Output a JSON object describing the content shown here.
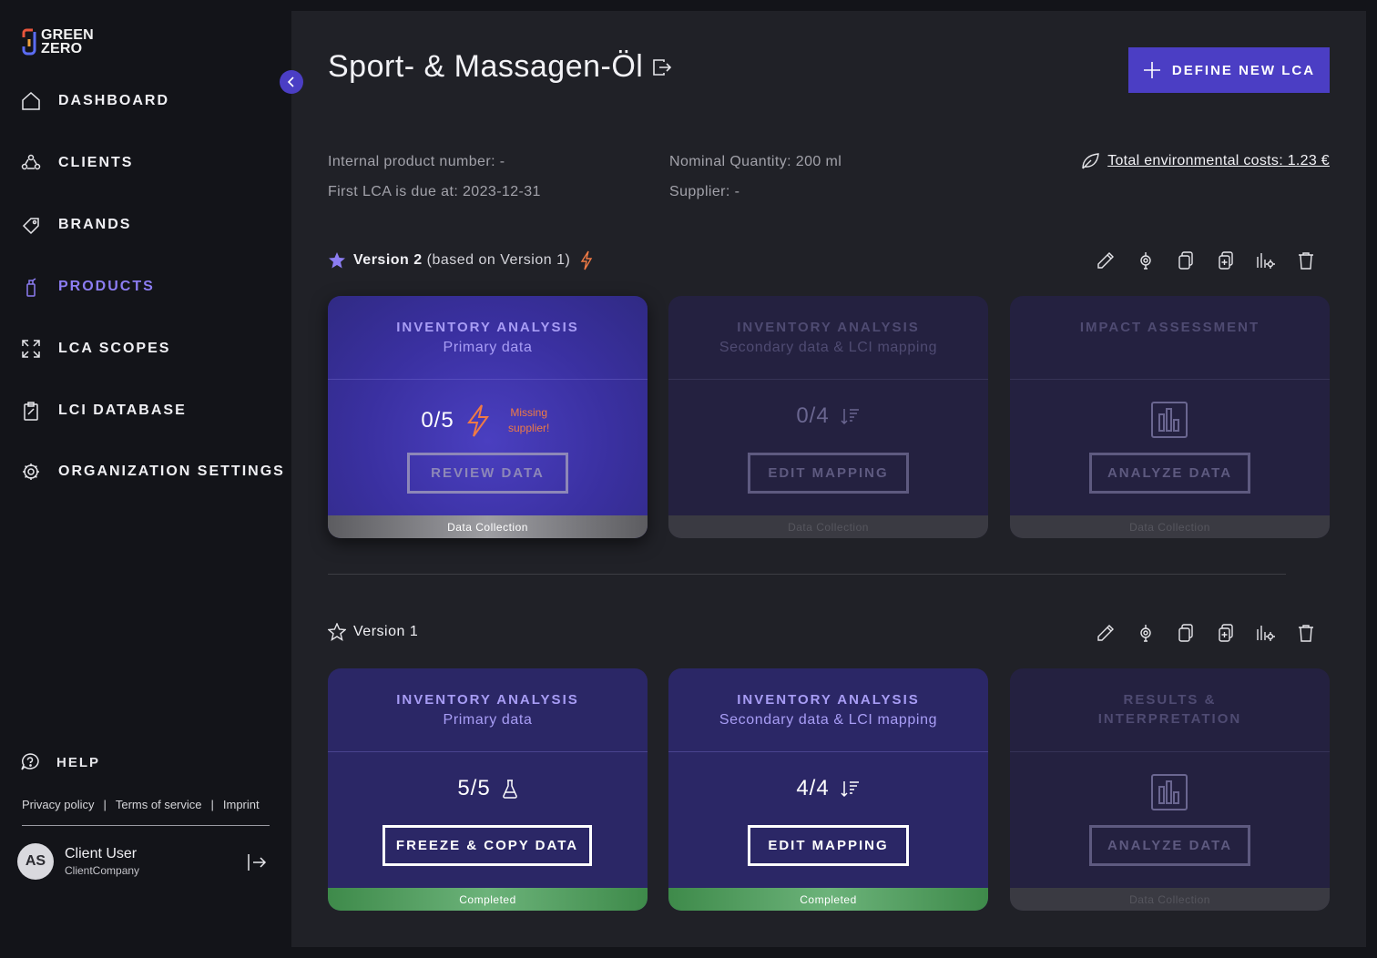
{
  "brand": {
    "logo_line1": "GREEN",
    "logo_line2": "ZERO"
  },
  "sidebar": {
    "items": [
      {
        "label": "DASHBOARD",
        "icon": "home-icon"
      },
      {
        "label": "CLIENTS",
        "icon": "clients-icon"
      },
      {
        "label": "BRANDS",
        "icon": "tag-icon"
      },
      {
        "label": "PRODUCTS",
        "icon": "bottle-icon",
        "active": true
      },
      {
        "label": "LCA SCOPES",
        "icon": "expand-icon"
      },
      {
        "label": "LCI DATABASE",
        "icon": "clipboard-icon"
      },
      {
        "label": "ORGANIZATION SETTINGS",
        "icon": "gear-icon"
      }
    ],
    "help": "HELP",
    "footer_links": [
      "Privacy policy",
      "|",
      "Terms of service",
      "|",
      "Imprint"
    ],
    "user": {
      "initials": "AS",
      "name": "Client User",
      "company": "ClientCompany"
    }
  },
  "header": {
    "title": "Sport- & Massagen-Öl",
    "define_button": "DEFINE NEW LCA"
  },
  "meta": {
    "internal_product_number": "Internal product number: -",
    "first_lca_due": "First LCA is due at: 2023-12-31",
    "nominal_quantity": "Nominal Quantity: 200 ml",
    "supplier": "Supplier: -",
    "env_costs": "Total environmental costs: 1.23 €"
  },
  "versions": [
    {
      "title": "Version 2",
      "subtitle": "(based on Version 1)",
      "cards": [
        {
          "t1": "INVENTORY ANALYSIS",
          "t2": "Primary data",
          "count": "0/5",
          "warning": "Missing supplier!",
          "button": "REVIEW DATA",
          "status": "Data Collection"
        },
        {
          "t1": "INVENTORY ANALYSIS",
          "t2": "Secondary data & LCI mapping",
          "count": "0/4",
          "button": "EDIT MAPPING",
          "status": "Data Collection"
        },
        {
          "t1": "IMPACT ASSESSMENT",
          "t2": "",
          "button": "ANALYZE DATA",
          "status": "Data Collection"
        }
      ]
    },
    {
      "title": "Version 1",
      "cards": [
        {
          "t1": "INVENTORY ANALYSIS",
          "t2": "Primary data",
          "count": "5/5",
          "button": "FREEZE & COPY DATA",
          "status": "Completed"
        },
        {
          "t1": "INVENTORY ANALYSIS",
          "t2": "Secondary data & LCI mapping",
          "count": "4/4",
          "button": "EDIT MAPPING",
          "status": "Completed"
        },
        {
          "t1": "RESULTS &",
          "t1b": "INTERPRETATION",
          "button": "ANALYZE DATA",
          "status": "Data Collection"
        }
      ]
    }
  ],
  "colors": {
    "accent": "#4b3ec4",
    "accent_text": "#8c7df2",
    "warning": "#ef7a45",
    "completed": "#5aa86a"
  }
}
